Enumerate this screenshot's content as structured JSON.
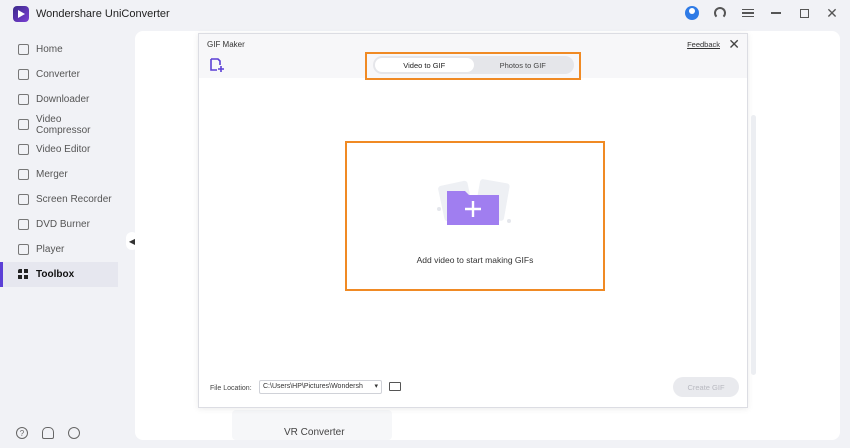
{
  "app": {
    "title": "Wondershare UniConverter"
  },
  "title_controls": [
    "user-icon",
    "headset-icon",
    "menu-icon",
    "minimize-icon",
    "maximize-icon",
    "close-icon"
  ],
  "sidebar": {
    "items": [
      {
        "label": "Home",
        "icon": "home-icon"
      },
      {
        "label": "Converter",
        "icon": "converter-icon"
      },
      {
        "label": "Downloader",
        "icon": "downloader-icon"
      },
      {
        "label": "Video Compressor",
        "icon": "compress-icon"
      },
      {
        "label": "Video Editor",
        "icon": "scissors-icon"
      },
      {
        "label": "Merger",
        "icon": "merge-icon"
      },
      {
        "label": "Screen Recorder",
        "icon": "record-icon"
      },
      {
        "label": "DVD Burner",
        "icon": "disc-icon"
      },
      {
        "label": "Player",
        "icon": "play-icon"
      },
      {
        "label": "Toolbox",
        "icon": "grid-icon",
        "active": true
      }
    ],
    "bottom_icons": [
      "help-icon",
      "bell-icon",
      "feedback-icon"
    ]
  },
  "dialog": {
    "title": "GIF Maker",
    "feedback": "Feedback",
    "close": "✕",
    "tabs": [
      {
        "label": "Video to GIF",
        "active": true
      },
      {
        "label": "Photos to GIF",
        "active": false
      }
    ],
    "drop_text": "Add video to start making GIFs",
    "file_location_label": "File Location:",
    "file_path": "C:\\Users\\HP\\Pictures\\Wondersh",
    "create_button": "Create GIF"
  },
  "background": {
    "vr_converter": "VR Converter"
  },
  "colors": {
    "accent": "#5b3fd6",
    "highlight": "#f08a24",
    "folder": "#a07ef0"
  }
}
